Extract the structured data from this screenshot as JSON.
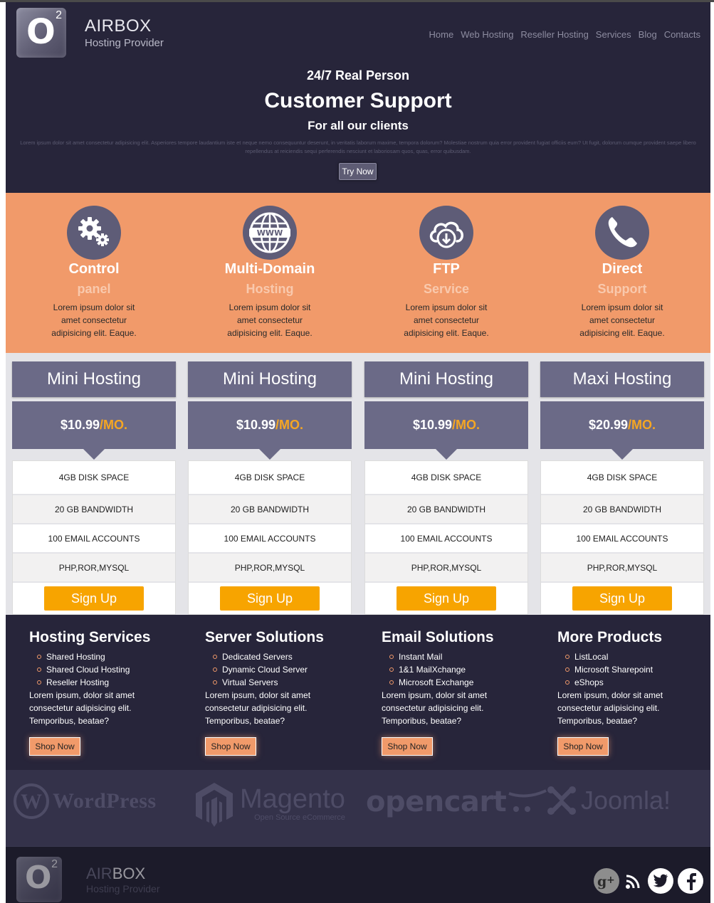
{
  "header": {
    "logo_mark": "O",
    "logo_sup": "2",
    "brand_name": "AIRBOX",
    "brand_sub": "Hosting Provider",
    "nav": [
      "Home",
      "Web Hosting",
      "Reseller Hosting",
      "Services",
      "Blog",
      "Contacts"
    ],
    "hero_line1": "24/7 Real Person",
    "hero_line2": "Customer Support",
    "hero_line3": "For all our clients",
    "hero_lorem": "Lorem ipsum dolor sit amet consectetur adipisicing elit. Asperiores tempore laudantium iste et neque nemo consequuntur deserunt, in veritatis laborum maxime, tempora dolorum? Molestiae nostrum quia error provident fugiat officiis eum? Ut fugit, dolorum cumque provident saepe libero repellendus at reiciendis sequi perferendis nesciunt et laboriosam quos, quas, error quibusdam.",
    "try_label": "Try Now"
  },
  "features": [
    {
      "icon": "gears-icon",
      "title": "Control",
      "sub": "panel",
      "desc": "Lorem ipsum dolor sit amet consectetur adipisicing elit. Eaque."
    },
    {
      "icon": "globe-www-icon",
      "title": "Multi-Domain",
      "sub": "Hosting",
      "desc": "Lorem ipsum dolor sit amet consectetur adipisicing elit. Eaque."
    },
    {
      "icon": "cloud-download-icon",
      "title": "FTP",
      "sub": "Service",
      "desc": "Lorem ipsum dolor sit amet consectetur adipisicing elit. Eaque."
    },
    {
      "icon": "phone-icon",
      "title": "Direct",
      "sub": "Support",
      "desc": "Lorem ipsum dolor sit amet consectetur adipisicing elit. Eaque."
    }
  ],
  "plans": [
    {
      "name": "Mini Hosting",
      "price": "$10.99",
      "per": "/MO.",
      "rows": [
        "4GB DISK SPACE",
        "20 GB BANDWIDTH",
        "100 EMAIL ACCOUNTS",
        "PHP,ROR,MYSQL"
      ],
      "cta": "Sign Up"
    },
    {
      "name": "Mini Hosting",
      "price": "$10.99",
      "per": "/MO.",
      "rows": [
        "4GB DISK SPACE",
        "20 GB BANDWIDTH",
        "100 EMAIL ACCOUNTS",
        "PHP,ROR,MYSQL"
      ],
      "cta": "Sign Up"
    },
    {
      "name": "Mini Hosting",
      "price": "$10.99",
      "per": "/MO.",
      "rows": [
        "4GB DISK SPACE",
        "20 GB BANDWIDTH",
        "100 EMAIL ACCOUNTS",
        "PHP,ROR,MYSQL"
      ],
      "cta": "Sign Up"
    },
    {
      "name": "Maxi Hosting",
      "price": "$20.99",
      "per": "/MO.",
      "rows": [
        "4GB DISK SPACE",
        "20 GB BANDWIDTH",
        "100 EMAIL ACCOUNTS",
        "PHP,ROR,MYSQL"
      ],
      "cta": "Sign Up"
    }
  ],
  "services": [
    {
      "title": "Hosting Services",
      "items": [
        "Shared Hosting",
        "Shared Cloud Hosting",
        "Reseller Hosting"
      ],
      "desc": "Lorem ipsum, dolor sit amet consectetur adipisicing elit. Temporibus, beatae?",
      "cta": "Shop Now"
    },
    {
      "title": "Server Solutions",
      "items": [
        "Dedicated Servers",
        "Dynamic Cloud Server",
        "Virtual Servers"
      ],
      "desc": "Lorem ipsum, dolor sit amet consectetur adipisicing elit. Temporibus, beatae?",
      "cta": "Shop Now"
    },
    {
      "title": "Email Solutions",
      "items": [
        "Instant Mail",
        "1&1 MailXchange",
        "Microsoft Exchange"
      ],
      "desc": "Lorem ipsum, dolor sit amet consectetur adipisicing elit. Temporibus, beatae?",
      "cta": "Shop Now"
    },
    {
      "title": "More Products",
      "items": [
        "ListLocal",
        "Microsoft Sharepoint",
        "eShops"
      ],
      "desc": "Lorem ipsum, dolor sit amet consectetur adipisicing elit. Temporibus, beatae?",
      "cta": "Shop Now"
    }
  ],
  "brands": {
    "wordpress": "WordPress",
    "magento": "Magento",
    "magento_sub": "Open Source eCommerce",
    "opencart": "opencart",
    "joomla": "Joomla!"
  },
  "bottom": {
    "brand_a": "AIR",
    "brand_b": "BOX",
    "brand_sub": "Hosting Provider",
    "social": [
      "google-plus-icon",
      "rss-icon",
      "twitter-icon",
      "facebook-icon"
    ]
  },
  "colors": {
    "dark": "#27253a",
    "orange": "#f19a6a",
    "plan": "#6b6a87",
    "accent": "#f7a400"
  }
}
